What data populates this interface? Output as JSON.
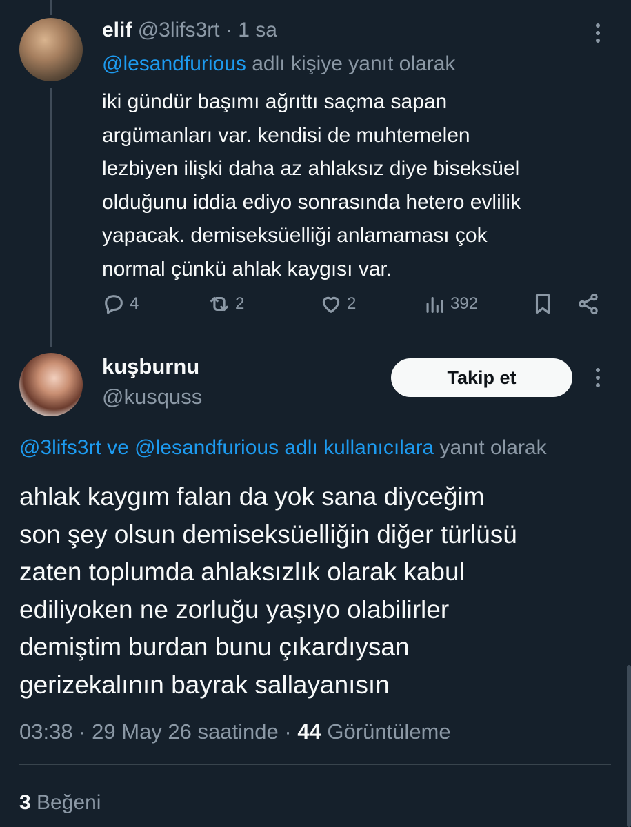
{
  "tweet1": {
    "name": "elif",
    "handle": "@3lifs3rt",
    "separator": "·",
    "time": "1 sa",
    "reply_to_handle": "@lesandfurious",
    "reply_to_suffix": "adlı kişiye yanıt olarak",
    "body_lines": [
      "iki gündür başımı ağrıttı saçma sapan",
      "argümanları var. kendisi de muhtemelen",
      "lezbiyen ilişki daha az ahlaksız diye biseksüel",
      "olduğunu iddia ediyo sonrasında hetero evlilik",
      "yapacak. demiseksüelliği anlamaması çok",
      "normal çünkü ahlak kaygısı var."
    ],
    "actions": {
      "replies": "4",
      "retweets": "2",
      "likes": "2",
      "views": "392"
    }
  },
  "tweet2": {
    "name": "kuşburnu",
    "handle": "@kusquss",
    "follow_label": "Takip et",
    "reply_to_users": "@3lifs3rt ve @lesandfurious adlı kullanıcılara",
    "reply_to_suffix": "yanıt olarak",
    "body_lines": [
      "ahlak kaygım falan da yok sana diyceğim",
      "son şey olsun demiseksüelliğin diğer türlüsü",
      "zaten toplumda ahlaksızlık olarak kabul",
      "ediliyoken ne zorluğu yaşıyo olabilirler",
      "demiştim burdan bunu çıkardıysan",
      "gerizekalının bayrak sallayanısın"
    ],
    "time": "03:38",
    "date": "29 May 26 saatinde",
    "separator": "·",
    "views_count": "44",
    "views_label": "Görüntüleme",
    "likes_count": "3",
    "likes_label": "Beğeni"
  },
  "colors": {
    "background": "#15202b",
    "link": "#1d9bf0",
    "muted": "#8b98a5",
    "text": "#f7f9f9"
  }
}
